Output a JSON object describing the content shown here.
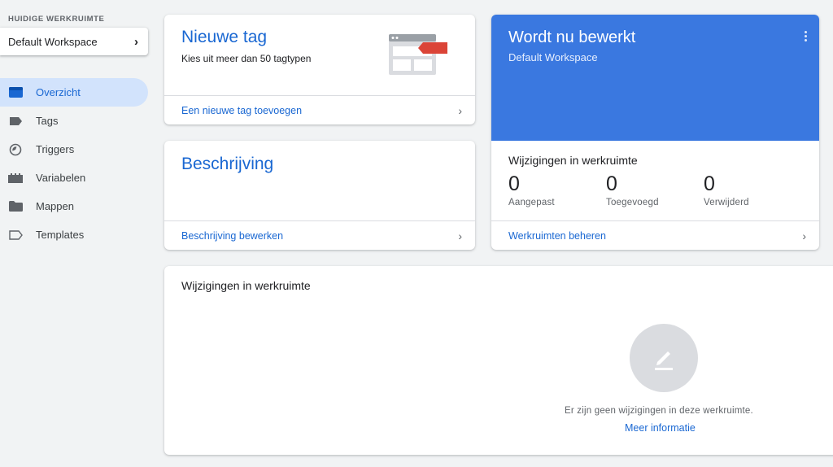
{
  "sidebar": {
    "workspace_label": "HUIDIGE WERKRUIMTE",
    "workspace_name": "Default Workspace",
    "items": [
      {
        "label": "Overzicht",
        "icon": "overview-icon"
      },
      {
        "label": "Tags",
        "icon": "tag-icon"
      },
      {
        "label": "Triggers",
        "icon": "trigger-icon"
      },
      {
        "label": "Variabelen",
        "icon": "variable-icon"
      },
      {
        "label": "Mappen",
        "icon": "folder-icon"
      },
      {
        "label": "Templates",
        "icon": "template-icon"
      }
    ],
    "active_index": 0
  },
  "new_tag": {
    "title": "Nieuwe tag",
    "subtitle": "Kies uit meer dan 50 tagtypen",
    "footer": "Een nieuwe tag toevoegen"
  },
  "description": {
    "title": "Beschrijving",
    "footer": "Beschrijving bewerken"
  },
  "editing": {
    "title": "Wordt nu bewerkt",
    "subtitle": "Default Workspace",
    "changes_title": "Wijzigingen in werkruimte",
    "stats": [
      {
        "value": "0",
        "label": "Aangepast"
      },
      {
        "value": "0",
        "label": "Toegevoegd"
      },
      {
        "value": "0",
        "label": "Verwijderd"
      }
    ],
    "footer": "Werkruimten beheren"
  },
  "changes": {
    "title": "Wijzigingen in werkruimte",
    "empty_text": "Er zijn geen wijzigingen in deze werkruimte.",
    "more_link": "Meer informatie"
  },
  "colors": {
    "accent": "#1967d2",
    "banner": "#3a78e0",
    "active_nav_bg": "#d2e3fc",
    "tag_red": "#db4437"
  }
}
